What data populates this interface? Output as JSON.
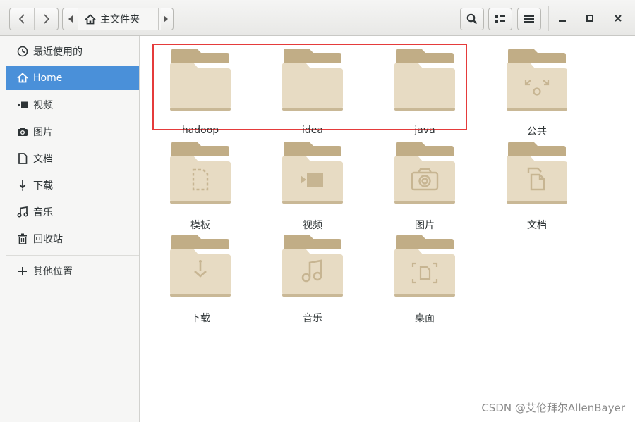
{
  "header": {
    "back_button": "back-arrow-icon",
    "forward_button": "forward-arrow-icon",
    "breadcrumb_label": "主文件夹",
    "breadcrumb_icon": "home-icon",
    "search_icon": "search-icon",
    "view_toggle_icon": "list-view-icon",
    "menu_icon": "hamburger-menu-icon",
    "window_controls": [
      "minimize-icon",
      "maximize-icon",
      "close-icon"
    ]
  },
  "sidebar": {
    "items": [
      {
        "label": "最近使用的",
        "icon": "clock-icon"
      },
      {
        "label": "Home",
        "icon": "home-icon",
        "active": true
      },
      {
        "label": "视频",
        "icon": "video-icon"
      },
      {
        "label": "图片",
        "icon": "camera-icon"
      },
      {
        "label": "文档",
        "icon": "document-icon"
      },
      {
        "label": "下载",
        "icon": "download-icon"
      },
      {
        "label": "音乐",
        "icon": "music-icon"
      },
      {
        "label": "回收站",
        "icon": "trash-icon"
      }
    ],
    "other_locations": {
      "label": "其他位置",
      "icon": "plus-icon"
    }
  },
  "folders": [
    {
      "name": "hadoop",
      "emblem": "none"
    },
    {
      "name": "idea",
      "emblem": "none"
    },
    {
      "name": "java",
      "emblem": "none"
    },
    {
      "name": "公共",
      "emblem": "share-icon"
    },
    {
      "name": "模板",
      "emblem": "template-icon"
    },
    {
      "name": "视频",
      "emblem": "video-icon"
    },
    {
      "name": "图片",
      "emblem": "camera-icon"
    },
    {
      "name": "文档",
      "emblem": "document-icon"
    },
    {
      "name": "下载",
      "emblem": "download-icon"
    },
    {
      "name": "音乐",
      "emblem": "music-icon"
    },
    {
      "name": "桌面",
      "emblem": "desktop-icon"
    }
  ],
  "highlight_color": "#e53b3b",
  "accent_color": "#4a90d9",
  "folder_color": "#d8c8a8",
  "watermark": "CSDN @艾伦拜尔AllenBayer"
}
